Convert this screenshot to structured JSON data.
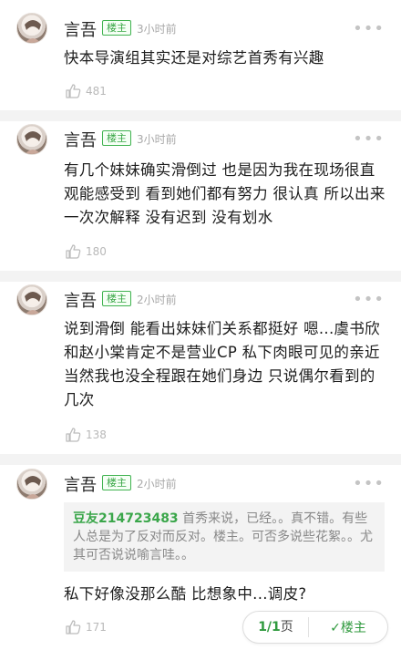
{
  "comments": [
    {
      "name": "言吾",
      "badge": "楼主",
      "time": "3小时前",
      "text": "快本导演组其实还是对综艺首秀有兴趣",
      "likes": "481"
    },
    {
      "name": "言吾",
      "badge": "楼主",
      "time": "3小时前",
      "text": "有几个妹妹确实滑倒过 也是因为我在现场很直观能感受到 看到她们都有努力 很认真 所以出来一次次解释 没有迟到 没有划水",
      "likes": "180"
    },
    {
      "name": "言吾",
      "badge": "楼主",
      "time": "2小时前",
      "text": "说到滑倒 能看出妹妹们关系都挺好 嗯...虞书欣和赵小棠肯定不是营业CP 私下肉眼可见的亲近 当然我也没全程跟在她们身边 只说偶尔看到的几次",
      "likes": "138"
    },
    {
      "name": "言吾",
      "badge": "楼主",
      "time": "2小时前",
      "quote_author": "豆友214723483",
      "quote_text": " 首秀来说，已经。。真不错。有些人总是为了反对而反对。楼主。可否多说些花絮。。尤其可否说说喻言哇。。",
      "text": "私下好像没那么酷 比想象中...调皮?",
      "likes": "171"
    }
  ],
  "more_glyph": "•••",
  "pager": {
    "current": "1/1",
    "suffix": "页",
    "filter_check": "✓",
    "filter_label": "楼主"
  },
  "icons": [
    "avatar",
    "thumbs-up-icon",
    "more-icon",
    "check-icon"
  ]
}
